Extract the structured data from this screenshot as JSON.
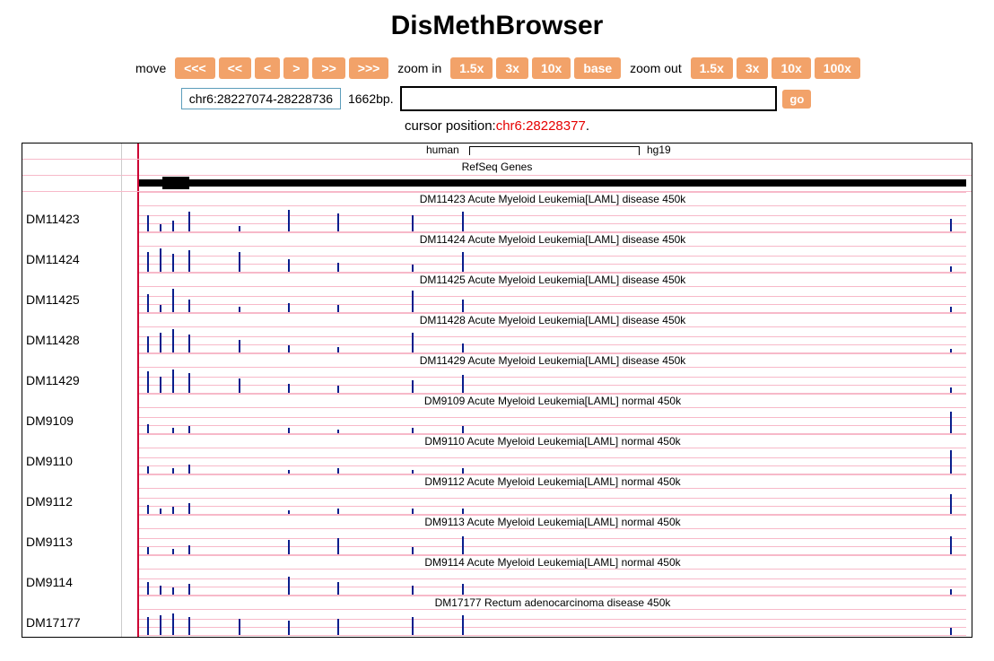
{
  "title": "DisMethBrowser",
  "controls": {
    "move_label": "move",
    "move_buttons": [
      "<<<",
      "<<",
      "<",
      ">",
      ">>",
      ">>>"
    ],
    "zoom_in_label": "zoom in",
    "zoom_in_buttons": [
      "1.5x",
      "3x",
      "10x",
      "base"
    ],
    "zoom_out_label": "zoom out",
    "zoom_out_buttons": [
      "1.5x",
      "3x",
      "10x",
      "100x"
    ],
    "position": "chr6:28227074-28228736",
    "span": "1662bp.",
    "search_value": "",
    "go_label": "go"
  },
  "cursor": {
    "prefix": "cursor position:",
    "value": "chr6:28228377",
    "suffix": "."
  },
  "ruler": {
    "left_label": "human",
    "right_label": "hg19"
  },
  "refseq_label": "RefSeq Genes",
  "tracks": [
    {
      "id": "DM11423",
      "title": "DM11423 Acute Myeloid Leukemia[LAML] disease 450k",
      "bars": [
        [
          1,
          18
        ],
        [
          2.5,
          8
        ],
        [
          4,
          12
        ],
        [
          6,
          22
        ],
        [
          12,
          6
        ],
        [
          18,
          24
        ],
        [
          24,
          20
        ],
        [
          33,
          18
        ],
        [
          39,
          22
        ],
        [
          98,
          14
        ]
      ]
    },
    {
      "id": "DM11424",
      "title": "DM11424 Acute Myeloid Leukemia[LAML] disease 450k",
      "bars": [
        [
          1,
          22
        ],
        [
          2.5,
          26
        ],
        [
          4,
          20
        ],
        [
          6,
          24
        ],
        [
          12,
          22
        ],
        [
          18,
          14
        ],
        [
          24,
          10
        ],
        [
          33,
          8
        ],
        [
          39,
          22
        ],
        [
          98,
          6
        ]
      ]
    },
    {
      "id": "DM11425",
      "title": "DM11425 Acute Myeloid Leukemia[LAML] disease 450k",
      "bars": [
        [
          1,
          20
        ],
        [
          2.5,
          8
        ],
        [
          4,
          26
        ],
        [
          6,
          14
        ],
        [
          12,
          6
        ],
        [
          18,
          10
        ],
        [
          24,
          8
        ],
        [
          33,
          24
        ],
        [
          39,
          14
        ],
        [
          98,
          6
        ]
      ]
    },
    {
      "id": "DM11428",
      "title": "DM11428 Acute Myeloid Leukemia[LAML] disease 450k",
      "bars": [
        [
          1,
          18
        ],
        [
          2.5,
          22
        ],
        [
          4,
          26
        ],
        [
          6,
          20
        ],
        [
          12,
          14
        ],
        [
          18,
          8
        ],
        [
          24,
          6
        ],
        [
          33,
          22
        ],
        [
          39,
          10
        ],
        [
          98,
          4
        ]
      ]
    },
    {
      "id": "DM11429",
      "title": "DM11429 Acute Myeloid Leukemia[LAML] disease 450k",
      "bars": [
        [
          1,
          24
        ],
        [
          2.5,
          18
        ],
        [
          4,
          26
        ],
        [
          6,
          22
        ],
        [
          12,
          16
        ],
        [
          18,
          10
        ],
        [
          24,
          8
        ],
        [
          33,
          14
        ],
        [
          39,
          20
        ],
        [
          98,
          6
        ]
      ]
    },
    {
      "id": "DM9109",
      "title": "DM9109 Acute Myeloid Leukemia[LAML] normal 450k",
      "bars": [
        [
          1,
          10
        ],
        [
          4,
          6
        ],
        [
          6,
          8
        ],
        [
          18,
          6
        ],
        [
          24,
          4
        ],
        [
          33,
          6
        ],
        [
          39,
          8
        ],
        [
          98,
          24
        ]
      ]
    },
    {
      "id": "DM9110",
      "title": "DM9110 Acute Myeloid Leukemia[LAML] normal 450k",
      "bars": [
        [
          1,
          8
        ],
        [
          4,
          6
        ],
        [
          6,
          10
        ],
        [
          18,
          4
        ],
        [
          24,
          6
        ],
        [
          33,
          4
        ],
        [
          39,
          6
        ],
        [
          98,
          26
        ]
      ]
    },
    {
      "id": "DM9112",
      "title": "DM9112 Acute Myeloid Leukemia[LAML] normal 450k",
      "bars": [
        [
          1,
          10
        ],
        [
          2.5,
          6
        ],
        [
          4,
          8
        ],
        [
          6,
          12
        ],
        [
          18,
          4
        ],
        [
          24,
          6
        ],
        [
          33,
          6
        ],
        [
          39,
          6
        ],
        [
          98,
          22
        ]
      ]
    },
    {
      "id": "DM9113",
      "title": "DM9113 Acute Myeloid Leukemia[LAML] normal 450k",
      "bars": [
        [
          1,
          8
        ],
        [
          4,
          6
        ],
        [
          6,
          10
        ],
        [
          18,
          16
        ],
        [
          24,
          18
        ],
        [
          33,
          8
        ],
        [
          39,
          20
        ],
        [
          98,
          20
        ]
      ]
    },
    {
      "id": "DM9114",
      "title": "DM9114 Acute Myeloid Leukemia[LAML] normal 450k",
      "bars": [
        [
          1,
          14
        ],
        [
          2.5,
          10
        ],
        [
          4,
          8
        ],
        [
          6,
          12
        ],
        [
          18,
          20
        ],
        [
          24,
          14
        ],
        [
          33,
          10
        ],
        [
          39,
          12
        ],
        [
          98,
          6
        ]
      ]
    },
    {
      "id": "DM17177",
      "title": "DM17177 Rectum adenocarcinoma disease 450k",
      "bars": [
        [
          1,
          20
        ],
        [
          2.5,
          22
        ],
        [
          4,
          24
        ],
        [
          6,
          20
        ],
        [
          12,
          18
        ],
        [
          18,
          16
        ],
        [
          24,
          18
        ],
        [
          33,
          20
        ],
        [
          39,
          22
        ],
        [
          98,
          8
        ]
      ]
    }
  ]
}
